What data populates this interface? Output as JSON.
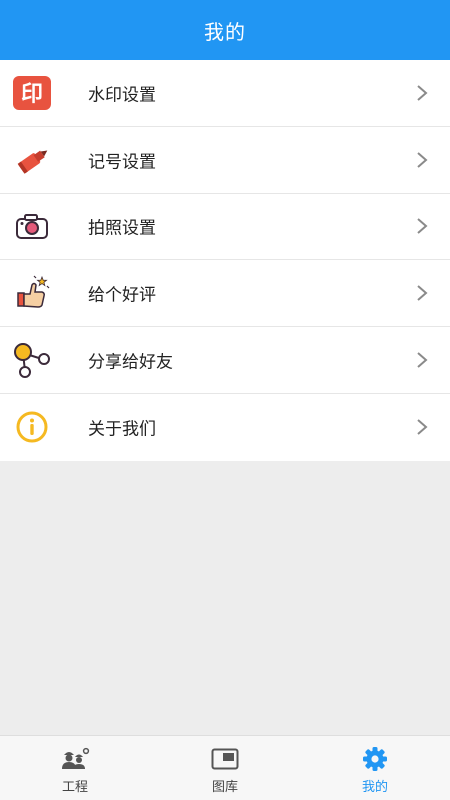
{
  "header": {
    "title": "我的"
  },
  "menu": {
    "items": [
      {
        "label": "水印设置",
        "icon": "watermark-stamp-icon",
        "icon_text": "印"
      },
      {
        "label": "记号设置",
        "icon": "marker-pen-icon"
      },
      {
        "label": "拍照设置",
        "icon": "camera-icon"
      },
      {
        "label": "给个好评",
        "icon": "thumbs-up-icon"
      },
      {
        "label": "分享给好友",
        "icon": "share-icon"
      },
      {
        "label": "关于我们",
        "icon": "info-icon"
      }
    ]
  },
  "tabbar": {
    "tabs": [
      {
        "label": "工程",
        "icon": "workers-icon",
        "active": false
      },
      {
        "label": "图库",
        "icon": "gallery-icon",
        "active": false
      },
      {
        "label": "我的",
        "icon": "settings-gear-icon",
        "active": true
      }
    ]
  },
  "colors": {
    "primary": "#2196f3",
    "stamp_red": "#e8533f",
    "info_yellow": "#f5b921",
    "page_bg": "#ededed"
  }
}
